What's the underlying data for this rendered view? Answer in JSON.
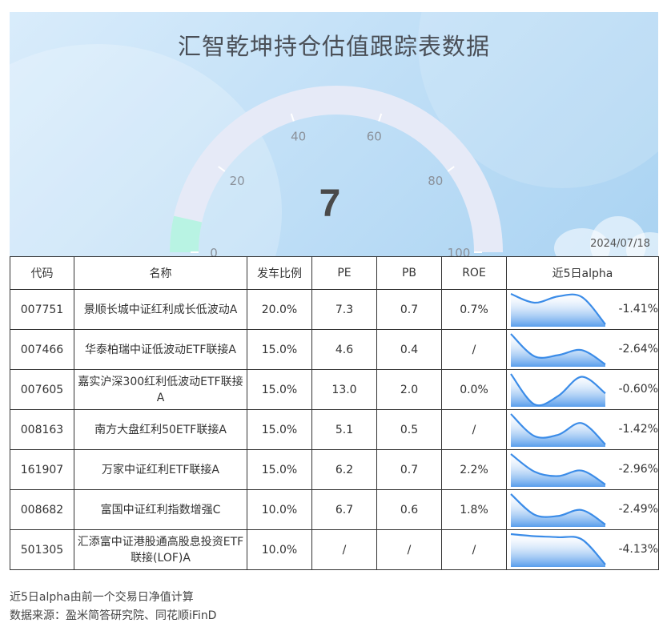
{
  "title": "汇智乾坤持仓估值跟踪表数据",
  "date": "2024/07/18",
  "gauge": {
    "value": "7",
    "min": 0,
    "max": 100,
    "tick_labels": [
      "0",
      "20",
      "40",
      "60",
      "80",
      "100"
    ],
    "track_color": "#e6eaf7",
    "fill_color": "#b8f3e3"
  },
  "table": {
    "headers": [
      "代码",
      "名称",
      "发车比例",
      "PE",
      "PB",
      "ROE",
      "近5日alpha"
    ],
    "rows": [
      {
        "code": "007751",
        "name": "景顺长城中证红利成长低波动A",
        "ratio": "20.0%",
        "pe": "7.3",
        "pb": "0.7",
        "roe": "0.7%",
        "alpha": "-1.41%"
      },
      {
        "code": "007466",
        "name": "华泰柏瑞中证低波动ETF联接A",
        "ratio": "15.0%",
        "pe": "4.6",
        "pb": "0.4",
        "roe": "/",
        "alpha": "-2.64%"
      },
      {
        "code": "007605",
        "name": "嘉实沪深300红利低波动ETF联接A",
        "ratio": "15.0%",
        "pe": "13.0",
        "pb": "2.0",
        "roe": "0.0%",
        "alpha": "-0.60%"
      },
      {
        "code": "008163",
        "name": "南方大盘红利50ETF联接A",
        "ratio": "15.0%",
        "pe": "5.1",
        "pb": "0.5",
        "roe": "/",
        "alpha": "-1.42%"
      },
      {
        "code": "161907",
        "name": "万家中证红利ETF联接A",
        "ratio": "15.0%",
        "pe": "6.2",
        "pb": "0.7",
        "roe": "2.2%",
        "alpha": "-2.96%"
      },
      {
        "code": "008682",
        "name": "富国中证红利指数增强C",
        "ratio": "10.0%",
        "pe": "6.7",
        "pb": "0.6",
        "roe": "1.8%",
        "alpha": "-2.49%"
      },
      {
        "code": "501305",
        "name": "汇添富中证港股通高股息投资ETF联接(LOF)A",
        "ratio": "10.0%",
        "pe": "/",
        "pb": "/",
        "roe": "/",
        "alpha": "-4.13%"
      }
    ]
  },
  "chart_data": {
    "type": "line",
    "series_color": "#3b8ce8",
    "sparklines": [
      [
        -0.2,
        -0.55,
        -0.3,
        -0.32,
        -1.41
      ],
      [
        -0.2,
        -2.0,
        -1.9,
        -1.5,
        -2.64
      ],
      [
        0.1,
        -1.0,
        -0.7,
        0.0,
        -0.6
      ],
      [
        -0.25,
        -1.1,
        -1.05,
        -0.6,
        -1.42
      ],
      [
        -0.2,
        -1.8,
        -2.2,
        -1.7,
        -2.96
      ],
      [
        -0.2,
        -1.75,
        -1.85,
        -1.4,
        -2.49
      ],
      [
        -1.2,
        -1.4,
        -1.5,
        -1.7,
        -4.13
      ]
    ]
  },
  "notes": [
    "近5日alpha由前一个交易日净值计算",
    "数据来源：盈米简答研究院、同花顺iFinD"
  ]
}
